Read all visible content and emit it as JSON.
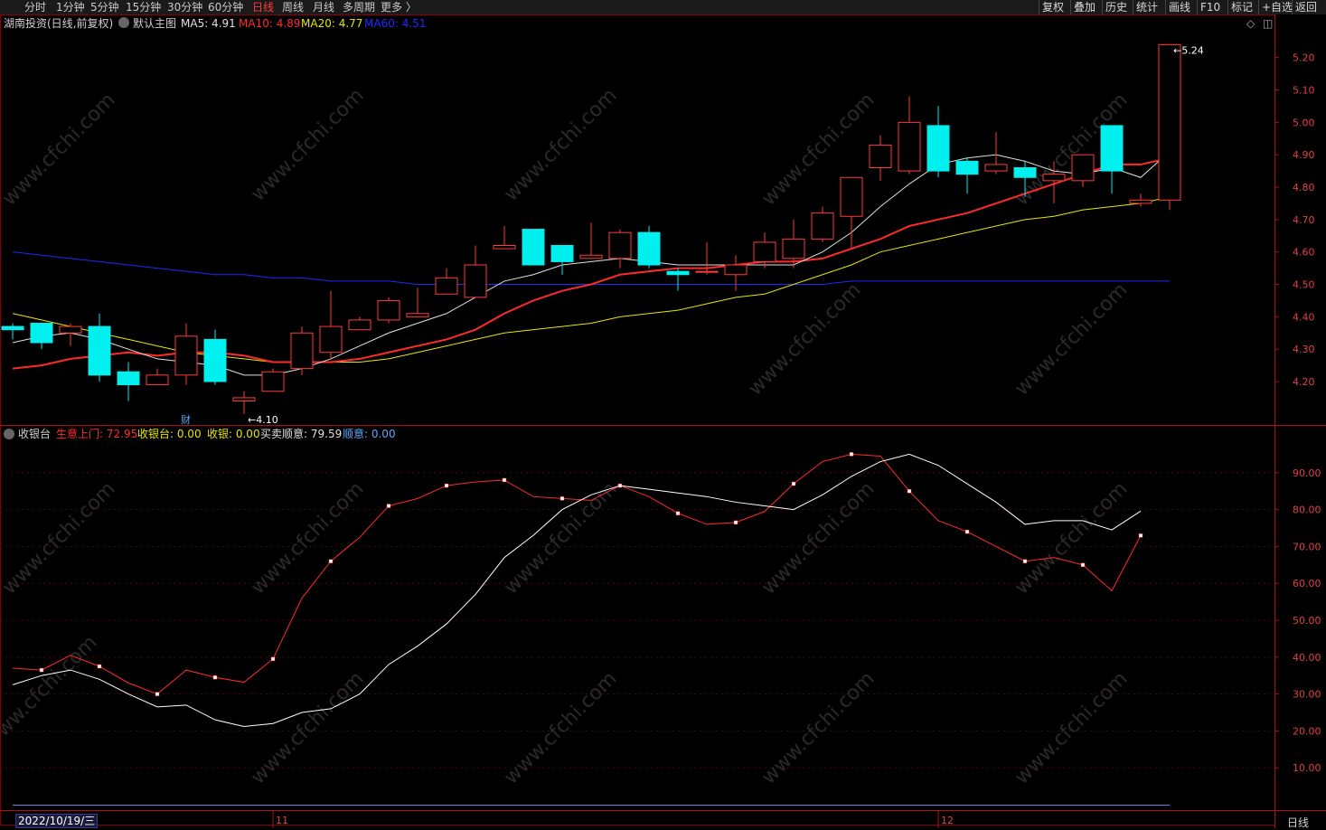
{
  "periods": [
    "分时",
    "1分钟",
    "5分钟",
    "15分钟",
    "30分钟",
    "60分钟",
    "日线",
    "周线",
    "月线",
    "多周期",
    "更多 〉"
  ],
  "active_period": "日线",
  "right_buttons": [
    "复权",
    "叠加",
    "历史",
    "统计",
    "画线",
    "F10",
    "标记",
    "+自选",
    "返回"
  ],
  "stock_title": "湖南投资(日线,前复权)",
  "main_chart_label": "默认主图",
  "ma_labels": [
    {
      "text": "MA5: 4.91",
      "color": "#e0e0e0"
    },
    {
      "text": "MA10: 4.89",
      "color": "#ff2a2a"
    },
    {
      "text": "MA20: 4.77",
      "color": "#e6e600"
    },
    {
      "text": "MA60: 4.51",
      "color": "#1a2aff"
    }
  ],
  "sub_indicator_name": "收银台",
  "sub_labels": [
    {
      "text": "生意上门: 72.95",
      "color": "#ff2a2a"
    },
    {
      "text": "收银台: 0.00",
      "color": "#e6e600"
    },
    {
      "text": "收银: 0.00",
      "color": "#e6e600"
    },
    {
      "text": "买卖顺意: 79.59",
      "color": "#e0e0e0"
    },
    {
      "text": "顺意: 0.00",
      "color": "#5aa8ff"
    }
  ],
  "finance_marker": "财",
  "low_annotation": "4.10",
  "high_annotation": "5.24",
  "date_label": "2022/10/19/三",
  "month_labels": [
    "11",
    "12"
  ],
  "period_status": "日线",
  "watermark": "www.cfchi.com",
  "colors": {
    "up": "#ff3b3b",
    "down": "#00f0f0",
    "axis": "#b01010",
    "grid": "#5a0000"
  },
  "chart_data": [
    {
      "type": "candlestick",
      "y_ticks": [
        4.2,
        4.3,
        4.4,
        4.5,
        4.6,
        4.7,
        4.8,
        4.9,
        5.0,
        5.1,
        5.2
      ],
      "ylim": [
        4.08,
        5.28
      ],
      "candles": [
        {
          "o": 4.37,
          "h": 4.38,
          "l": 4.33,
          "c": 4.36
        },
        {
          "o": 4.38,
          "h": 4.38,
          "l": 4.3,
          "c": 4.32
        },
        {
          "o": 4.35,
          "h": 4.38,
          "l": 4.31,
          "c": 4.37
        },
        {
          "o": 4.37,
          "h": 4.41,
          "l": 4.2,
          "c": 4.22
        },
        {
          "o": 4.23,
          "h": 4.26,
          "l": 4.14,
          "c": 4.19
        },
        {
          "o": 4.19,
          "h": 4.24,
          "l": 4.19,
          "c": 4.22
        },
        {
          "o": 4.22,
          "h": 4.38,
          "l": 4.19,
          "c": 4.34
        },
        {
          "o": 4.33,
          "h": 4.36,
          "l": 4.19,
          "c": 4.2
        },
        {
          "o": 4.14,
          "h": 4.17,
          "l": 4.1,
          "c": 4.15
        },
        {
          "o": 4.17,
          "h": 4.24,
          "l": 4.17,
          "c": 4.23
        },
        {
          "o": 4.24,
          "h": 4.37,
          "l": 4.22,
          "c": 4.35
        },
        {
          "o": 4.29,
          "h": 4.48,
          "l": 4.27,
          "c": 4.37
        },
        {
          "o": 4.36,
          "h": 4.4,
          "l": 4.36,
          "c": 4.39
        },
        {
          "o": 4.39,
          "h": 4.46,
          "l": 4.38,
          "c": 4.45
        },
        {
          "o": 4.4,
          "h": 4.49,
          "l": 4.4,
          "c": 4.41
        },
        {
          "o": 4.47,
          "h": 4.55,
          "l": 4.47,
          "c": 4.52
        },
        {
          "o": 4.46,
          "h": 4.62,
          "l": 4.46,
          "c": 4.56
        },
        {
          "o": 4.61,
          "h": 4.68,
          "l": 4.61,
          "c": 4.62
        },
        {
          "o": 4.67,
          "h": 4.67,
          "l": 4.56,
          "c": 4.56
        },
        {
          "o": 4.62,
          "h": 4.62,
          "l": 4.53,
          "c": 4.57
        },
        {
          "o": 4.58,
          "h": 4.69,
          "l": 4.58,
          "c": 4.59
        },
        {
          "o": 4.58,
          "h": 4.67,
          "l": 4.55,
          "c": 4.66
        },
        {
          "o": 4.66,
          "h": 4.68,
          "l": 4.55,
          "c": 4.56
        },
        {
          "o": 4.54,
          "h": 4.55,
          "l": 4.48,
          "c": 4.53
        },
        {
          "o": 4.54,
          "h": 4.63,
          "l": 4.53,
          "c": 4.54
        },
        {
          "o": 4.53,
          "h": 4.59,
          "l": 4.48,
          "c": 4.56
        },
        {
          "o": 4.57,
          "h": 4.66,
          "l": 4.55,
          "c": 4.63
        },
        {
          "o": 4.58,
          "h": 4.7,
          "l": 4.55,
          "c": 4.64
        },
        {
          "o": 4.64,
          "h": 4.74,
          "l": 4.63,
          "c": 4.72
        },
        {
          "o": 4.71,
          "h": 4.83,
          "l": 4.61,
          "c": 4.83
        },
        {
          "o": 4.86,
          "h": 4.96,
          "l": 4.82,
          "c": 4.93
        },
        {
          "o": 4.85,
          "h": 5.08,
          "l": 4.84,
          "c": 5.0
        },
        {
          "o": 4.99,
          "h": 5.05,
          "l": 4.83,
          "c": 4.85
        },
        {
          "o": 4.88,
          "h": 4.89,
          "l": 4.78,
          "c": 4.84
        },
        {
          "o": 4.85,
          "h": 4.97,
          "l": 4.84,
          "c": 4.87
        },
        {
          "o": 4.86,
          "h": 4.88,
          "l": 4.77,
          "c": 4.83
        },
        {
          "o": 4.82,
          "h": 4.88,
          "l": 4.75,
          "c": 4.84
        },
        {
          "o": 4.82,
          "h": 4.89,
          "l": 4.8,
          "c": 4.9
        },
        {
          "o": 4.99,
          "h": 4.99,
          "l": 4.78,
          "c": 4.85
        },
        {
          "o": 4.75,
          "h": 4.78,
          "l": 4.74,
          "c": 4.76
        },
        {
          "o": 4.76,
          "h": 5.24,
          "l": 4.73,
          "c": 5.24
        }
      ],
      "ma5": [
        4.32,
        4.34,
        4.35,
        4.33,
        4.3,
        4.27,
        4.26,
        4.25,
        4.22,
        4.22,
        4.24,
        4.27,
        4.31,
        4.35,
        4.38,
        4.41,
        4.46,
        4.51,
        4.53,
        4.56,
        4.57,
        4.58,
        4.57,
        4.56,
        4.56,
        4.56,
        4.56,
        4.56,
        4.6,
        4.66,
        4.74,
        4.81,
        4.87,
        4.89,
        4.9,
        4.88,
        4.85,
        4.84,
        4.86,
        4.83,
        4.91
      ],
      "ma10": [
        4.24,
        4.25,
        4.27,
        4.28,
        4.29,
        4.28,
        4.29,
        4.29,
        4.28,
        4.26,
        4.26,
        4.26,
        4.27,
        4.29,
        4.31,
        4.33,
        4.36,
        4.41,
        4.45,
        4.48,
        4.5,
        4.53,
        4.54,
        4.55,
        4.55,
        4.56,
        4.57,
        4.57,
        4.58,
        4.61,
        4.64,
        4.68,
        4.7,
        4.72,
        4.75,
        4.78,
        4.81,
        4.84,
        4.87,
        4.87,
        4.89
      ],
      "ma20": [
        4.41,
        4.39,
        4.37,
        4.35,
        4.33,
        4.31,
        4.29,
        4.28,
        4.27,
        4.26,
        4.26,
        4.26,
        4.26,
        4.27,
        4.29,
        4.31,
        4.33,
        4.35,
        4.36,
        4.37,
        4.38,
        4.4,
        4.41,
        4.42,
        4.44,
        4.46,
        4.47,
        4.5,
        4.53,
        4.56,
        4.6,
        4.62,
        4.64,
        4.66,
        4.68,
        4.7,
        4.71,
        4.73,
        4.74,
        4.75,
        4.77
      ],
      "ma60": [
        4.6,
        4.59,
        4.58,
        4.57,
        4.56,
        4.55,
        4.54,
        4.53,
        4.53,
        4.52,
        4.52,
        4.51,
        4.51,
        4.51,
        4.5,
        4.5,
        4.5,
        4.5,
        4.5,
        4.5,
        4.5,
        4.5,
        4.5,
        4.5,
        4.5,
        4.5,
        4.5,
        4.5,
        4.5,
        4.51,
        4.51,
        4.51,
        4.51,
        4.51,
        4.51,
        4.51,
        4.51,
        4.51,
        4.51,
        4.51,
        4.51
      ]
    },
    {
      "type": "line",
      "y_ticks": [
        10,
        20,
        30,
        40,
        50,
        60,
        70,
        80,
        90
      ],
      "ylim": [
        0,
        100
      ],
      "series": [
        {
          "name": "生意上门",
          "color": "#ff2a2a",
          "values": [
            37,
            36.5,
            40.5,
            37.5,
            33,
            30,
            36.5,
            34.5,
            33.2,
            39.5,
            56,
            66,
            72.5,
            81,
            83,
            86.5,
            87.5,
            88,
            83.5,
            83,
            82.5,
            86.5,
            83.5,
            79,
            76,
            76.5,
            79.5,
            87,
            93,
            95,
            94.5,
            85,
            77,
            74,
            70,
            66,
            67,
            65,
            58,
            72.95
          ]
        },
        {
          "name": "买卖顺意",
          "color": "#ffffff",
          "values": [
            32.5,
            35,
            36.5,
            34,
            30,
            26.5,
            27,
            23,
            21.2,
            22,
            25,
            26,
            30,
            38,
            43,
            49,
            57,
            67,
            73,
            80,
            84,
            86.5,
            85.5,
            84.5,
            83.5,
            82,
            81,
            80,
            84,
            89,
            93,
            95,
            92,
            87,
            82,
            76,
            77,
            77,
            74.5,
            79.59
          ]
        }
      ]
    }
  ]
}
